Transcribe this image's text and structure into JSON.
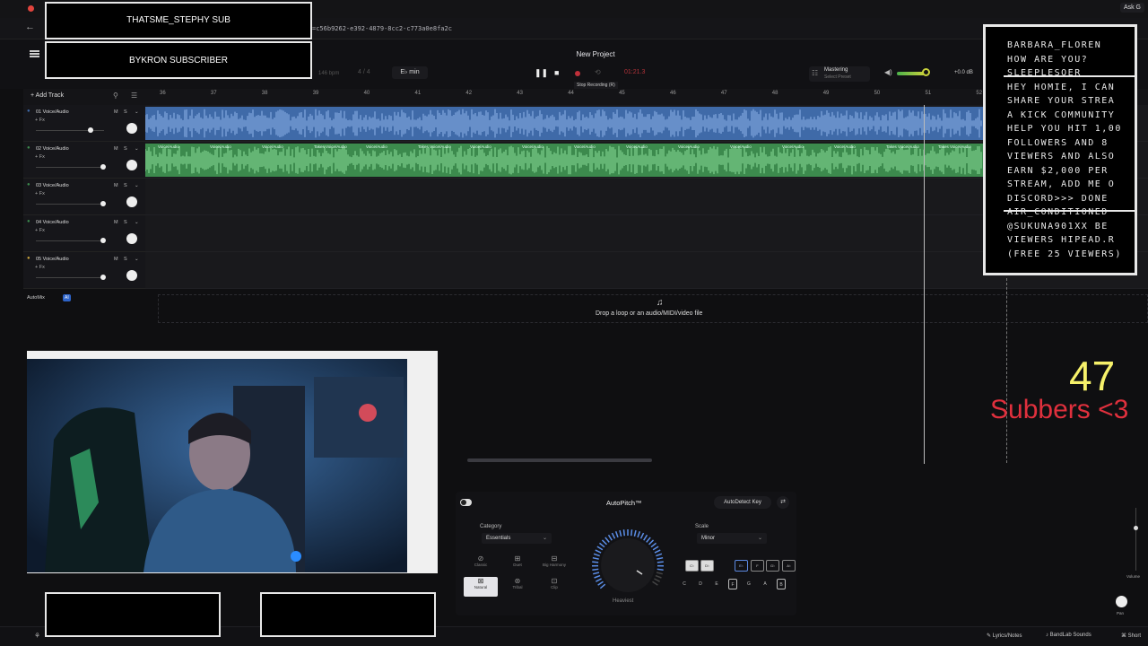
{
  "browser": {
    "url": "=c56b9262-e392-4879-8cc2-c773a0e8fa2c",
    "extension_label": "Ask G",
    "back_icon": "arrow-left-icon"
  },
  "transport": {
    "project_title": "New Project",
    "bpm": "146 bpm",
    "time_signature": "4 / 4",
    "key": "E♭ min",
    "time_display": "01:21.3",
    "tooltip": "Stop Recording (R)",
    "mastering_title": "Mastering",
    "mastering_sub": "Select Preset",
    "volume_db": "+0.0 dB",
    "volume_level": 0.85
  },
  "tracks_header": {
    "add_track": "+ Add Track"
  },
  "ruler": [
    "36",
    "37",
    "38",
    "39",
    "40",
    "41",
    "42",
    "43",
    "44",
    "45",
    "46",
    "47",
    "48",
    "49",
    "50",
    "51",
    "52"
  ],
  "tracks": [
    {
      "name": "01 Voice/Audio",
      "fx": "+ Fx",
      "mute": "M",
      "solo": "S",
      "color": "#3f6aa8",
      "volume": 0.8
    },
    {
      "name": "02 Voice/Audio",
      "fx": "+ Fx",
      "mute": "M",
      "solo": "S",
      "color": "#3c8a4d",
      "volume": 1.0
    },
    {
      "name": "03 Voice/Audio",
      "fx": "+ Fx",
      "mute": "M",
      "solo": "S",
      "color": "#3c8a4d",
      "volume": 1.0
    },
    {
      "name": "04 Voice/Audio",
      "fx": "+ Fx",
      "mute": "M",
      "solo": "S",
      "color": "#3c8a4d",
      "volume": 1.0
    },
    {
      "name": "05 Voice/Audio",
      "fx": "+ Fx",
      "mute": "M",
      "solo": "S",
      "color": "#c8a23c",
      "volume": 1.0
    }
  ],
  "clip_labels": [
    "Voice/Audio",
    "Voice/Audio",
    "Voice/Audio",
    "Takes Voice/Audio",
    "Voice/Audio",
    "Takes Voice/Audio",
    "Voice/Audio",
    "Voice/Audio",
    "Voice/Audio",
    "Voice/Audio",
    "Voice/Audio",
    "Voice/Audio",
    "Voice/Audio",
    "Voice/Audio",
    "Takes Voice/Audio",
    "Takes Voice/Audio"
  ],
  "automix": {
    "label": "AutoMix",
    "badge": "AI"
  },
  "drop_zone": {
    "text": "Drop a loop or an audio/MIDI/video file"
  },
  "autopitch": {
    "title": "AutoPitch™",
    "detect_key": "AutoDetect Key",
    "category_label": "Category",
    "category_value": "Essentials",
    "scale_label": "Scale",
    "scale_value": "Minor",
    "presets": [
      "Classic",
      "Duet",
      "Big Harmony",
      "Natural",
      "Tribal",
      "Clip"
    ],
    "knob_label": "Heaviest",
    "chords": [
      "C♭",
      "D♭",
      "E♭",
      "F",
      "G♭",
      "A♭"
    ],
    "notes": [
      "C",
      "D",
      "E",
      "F",
      "G",
      "A",
      "B"
    ]
  },
  "right_panel": {
    "volume": "Volume",
    "pan": "Pan"
  },
  "bottom_bar": {
    "lyrics": "Lyrics/Notes",
    "sounds": "BandLab Sounds",
    "shortcuts": "Short"
  },
  "overlays": {
    "banner1": "THATSME_STEPHY SUB",
    "banner2": "BYKRON SUBSCRIBER",
    "chat": [
      "BARBARA_FLOREN",
      "HOW ARE YOU?",
      "SLEEPLESQER",
      "HEY HOMIE, I CAN",
      "SHARE YOUR STREA",
      "A KICK COMMUNITY",
      "HELP YOU HIT 1,00",
      "FOLLOWERS AND 8",
      "VIEWERS AND ALSO",
      "EARN $2,000 PER",
      "STREAM, ADD ME O",
      "DISCORD>>> DONE",
      "AIR_CONDITIONED",
      "@SUKUNA901XX BE",
      "VIEWERS HIPEAD.R",
      "(FREE 25 VIEWERS)"
    ],
    "sub_count": "47",
    "sub_text": "Subbers <3"
  }
}
